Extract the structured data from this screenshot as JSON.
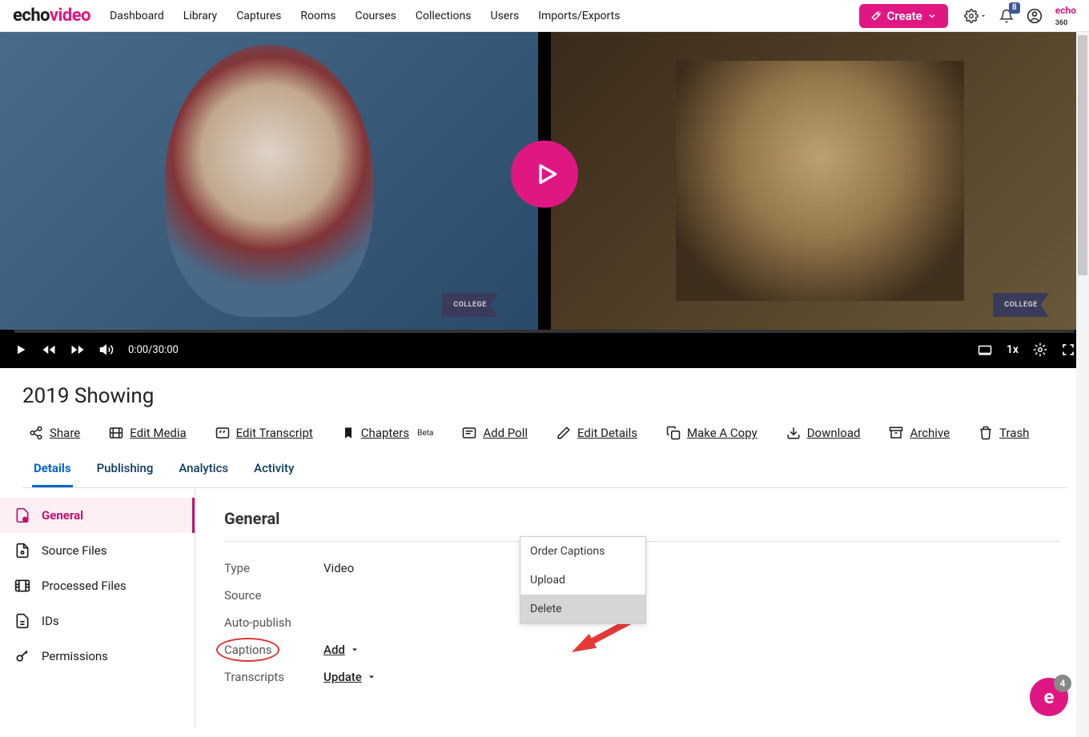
{
  "brand": {
    "part1": "echo",
    "part2": "video",
    "mini": "echo",
    "mini360": "360"
  },
  "nav": {
    "items": [
      "Dashboard",
      "Library",
      "Captures",
      "Rooms",
      "Courses",
      "Collections",
      "Users",
      "Imports/Exports"
    ],
    "create": "Create",
    "notif_count": "8"
  },
  "player": {
    "pennant": "COLLEGE",
    "time": "0:00/30:00",
    "speed": "1x"
  },
  "media": {
    "title": "2019 Showing"
  },
  "actions": {
    "share": "Share",
    "edit_media": "Edit Media",
    "edit_transcript": "Edit Transcript",
    "chapters": "Chapters",
    "chapters_beta": "Beta",
    "add_poll": "Add Poll",
    "edit_details": "Edit Details",
    "make_copy": "Make A Copy",
    "download": "Download",
    "archive": "Archive",
    "trash": "Trash"
  },
  "tabs": [
    "Details",
    "Publishing",
    "Analytics",
    "Activity"
  ],
  "sidebar": {
    "items": [
      {
        "label": "General"
      },
      {
        "label": "Source Files"
      },
      {
        "label": "Processed Files"
      },
      {
        "label": "IDs"
      },
      {
        "label": "Permissions"
      }
    ]
  },
  "panel": {
    "title": "General",
    "rows": {
      "type_k": "Type",
      "type_v": "Video",
      "source_k": "Source",
      "autopub_k": "Auto-publish",
      "captions_k": "Captions",
      "captions_v": "Add",
      "transcripts_k": "Transcripts",
      "transcripts_v": "Update"
    }
  },
  "popup": {
    "order": "Order Captions",
    "upload": "Upload",
    "delete": "Delete"
  },
  "help": {
    "letter": "e",
    "count": "4"
  }
}
